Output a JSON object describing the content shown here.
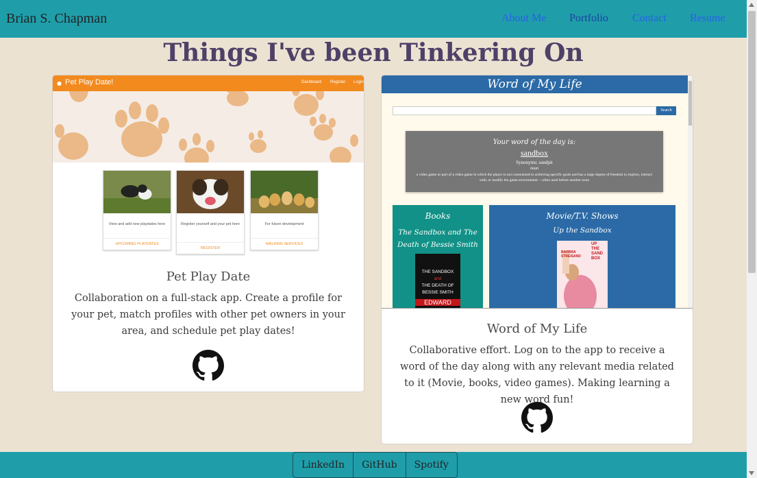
{
  "navbar": {
    "brand": "Brian S. Chapman",
    "links": [
      "About Me",
      "Portfolio",
      "Contact",
      "Resume"
    ]
  },
  "page_title": "Things I've been Tinkering On",
  "projects": [
    {
      "title": "Pet Play Date",
      "description": "Collaboration on a full-stack app. Create a profile for your pet, match profiles with other pet owners in your area, and schedule pet play dates!",
      "preview": {
        "brand": "Pet Play Date!",
        "nav": [
          "Dashboard",
          "Register",
          "Login"
        ],
        "cards": [
          {
            "text": "View and add new playdates here",
            "link": "UPCOMING PLAYDATES"
          },
          {
            "text": "Register yourself and your pet here",
            "link": "REGISTER"
          },
          {
            "text": "For future development",
            "link": "WALKING SERVICES"
          }
        ]
      }
    },
    {
      "title": "Word of My Life",
      "description": "Collaborative effort. Log on to the app to receive a word of the day along with any relevant media related to it (Movie, books, video games). Making learning a new word fun!",
      "preview": {
        "brand": "Word of My Life",
        "search_button": "Search",
        "wod_heading": "Your word of the day is:",
        "word": "sandbox",
        "synonyms": "Synonyms: sandpit",
        "part_of_speech": "noun",
        "definition": "a video game or part of a video game in which the player is not constrained to achieving specific goals and has a large degree of freedom to explore, interact with, or modify the game environment —often used before another noun",
        "books_heading": "Books",
        "book_title": "The Sandbox and The Death of Bessie Smith",
        "book_cover": [
          "THE SANDBOX",
          "and",
          "THE DEATH OF BESSIE SMITH",
          "EDWARD"
        ],
        "movies_heading": "Movie/T.V. Shows",
        "movie_title": "Up the Sandbox",
        "movie_cover": [
          "BARBRA",
          "STREISAND",
          "UP",
          "THE",
          "SAND",
          "BOX"
        ]
      }
    }
  ],
  "footer": {
    "buttons": [
      "LinkedIn",
      "GitHub",
      "Spotify"
    ]
  },
  "colors": {
    "navbar": "#1f9eaa",
    "page_bg": "#ece2d2",
    "title": "#4e4168",
    "pet_orange": "#f28a1e",
    "wl_blue": "#2b6aa6",
    "wl_teal": "#119187"
  }
}
